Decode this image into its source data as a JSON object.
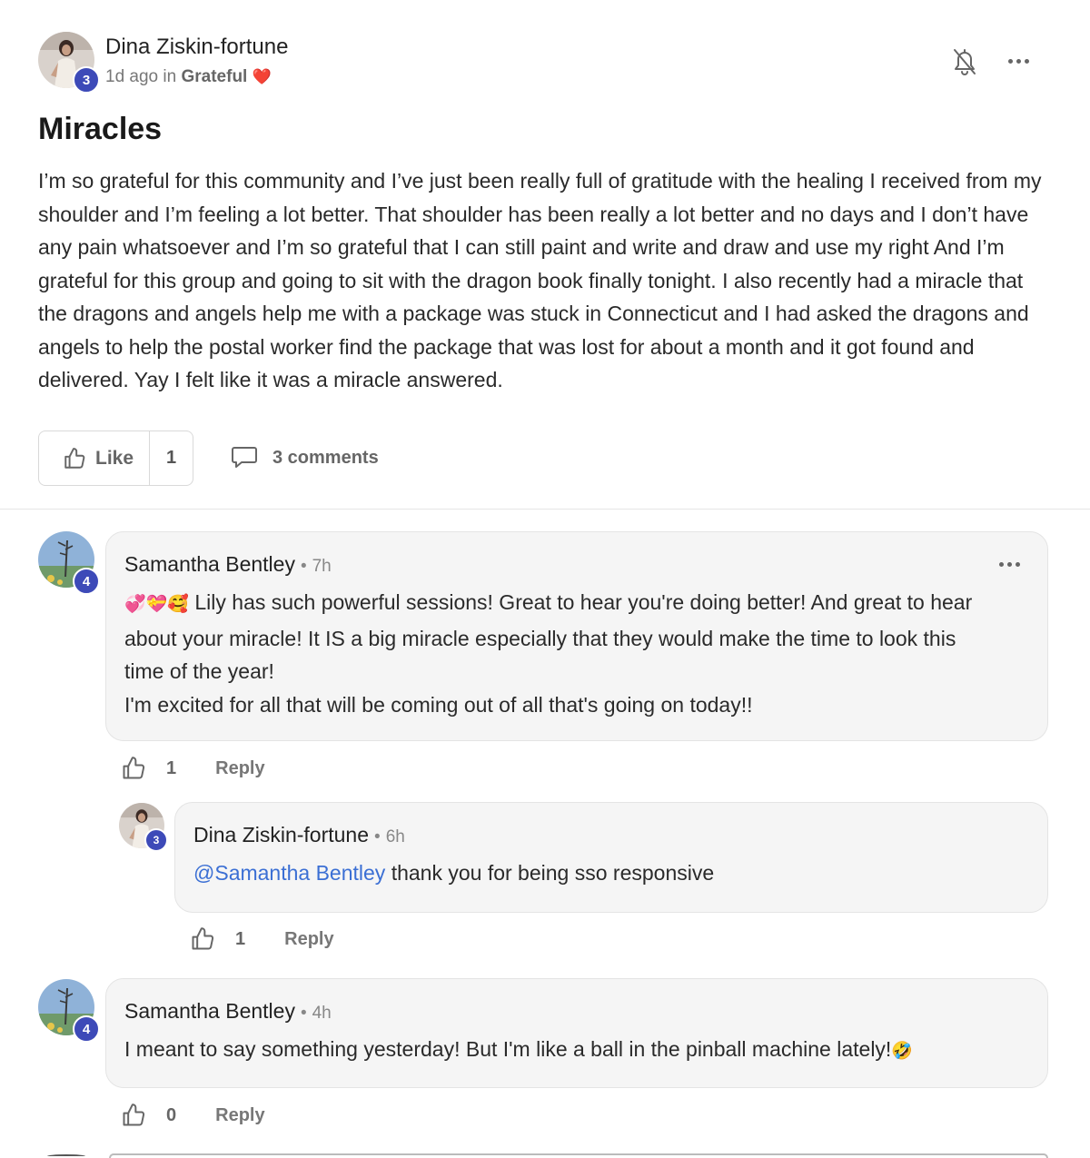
{
  "post": {
    "author": "Dina Ziskin-fortune",
    "author_level": "3",
    "time": "1d ago",
    "in_word": "in",
    "space": "Grateful",
    "space_emoji": "❤️",
    "title": "Miracles",
    "body": "I’m so grateful for this community and I’ve just been really full of gratitude with the healing I received from my shoulder and I’m feeling a lot better. That shoulder has been really a lot better and no days and I don’t have any pain whatsoever and I’m so grateful that I can still paint and write and draw and use my right And I’m grateful for this group and going to sit with the dragon book finally tonight. I also recently had a miracle that the dragons and angels help me with a package was stuck in Connecticut and I had asked the dragons and angels to help the postal worker find the package that was lost for about a month and it got found and delivered. Yay I felt like it was a miracle answered.",
    "like_label": "Like",
    "like_count": "1",
    "comments_label": "3 comments",
    "icons": {
      "bell": "bell-off-icon",
      "more": "more-icon",
      "like": "thumbs-up-icon",
      "comment": "comment-icon"
    }
  },
  "comments": [
    {
      "author": "Samantha Bentley",
      "author_level": "4",
      "sep": "•",
      "time": "7h",
      "emoji": "💞💝🥰",
      "text_lines": [
        " Lily has such powerful sessions! Great to hear you're doing better! And great to hear",
        "about your miracle! It IS a big miracle especially that they would make the time to look this",
        "time of the year!",
        "I'm excited for all that will be coming out of all that's going on today!!"
      ],
      "like_count": "1",
      "reply_label": "Reply"
    },
    {
      "author": "Dina Ziskin-fortune",
      "author_level": "3",
      "sep": "•",
      "time": "6h",
      "mention": "@Samantha Bentley",
      "text": " thank you for being sso responsive",
      "like_count": "1",
      "reply_label": "Reply"
    },
    {
      "author": "Samantha Bentley",
      "author_level": "4",
      "sep": "•",
      "time": "4h",
      "text": "I meant to say something yesterday! But I'm like a ball in the pinball machine lately!",
      "emoji": "🤣",
      "like_count": "0",
      "reply_label": "Reply"
    }
  ],
  "colors": {
    "badge": "#3d4ab8",
    "mention": "#3b6fd4",
    "bubble": "#f5f5f5"
  }
}
